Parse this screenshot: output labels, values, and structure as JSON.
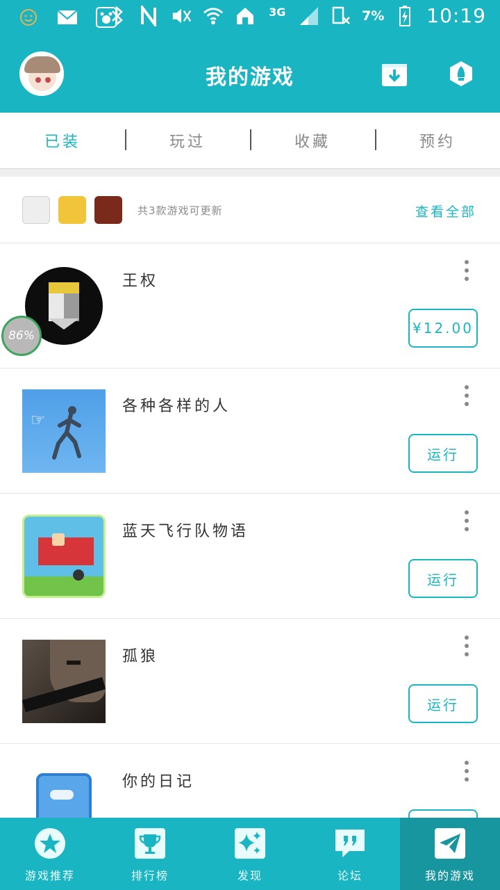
{
  "status_bar": {
    "network_label": "3G",
    "battery_percent": "7%",
    "time": "10:19"
  },
  "header": {
    "title": "我的游戏"
  },
  "tabs": [
    {
      "label": "已装",
      "active": true
    },
    {
      "label": "玩过",
      "active": false
    },
    {
      "label": "收藏",
      "active": false
    },
    {
      "label": "预约",
      "active": false
    }
  ],
  "updates": {
    "text": "共3款游戏可更新",
    "link": "查看全部"
  },
  "games": [
    {
      "name": "王权",
      "action": "¥12.00",
      "progress_badge": "86%"
    },
    {
      "name": "各种各样的人",
      "action": "运行"
    },
    {
      "name": "蓝天飞行队物语",
      "action": "运行"
    },
    {
      "name": "孤狼",
      "action": "运行"
    },
    {
      "name": "你的日记",
      "action": ""
    }
  ],
  "bottom_nav": [
    {
      "label": "游戏推荐",
      "icon": "star-icon",
      "active": false
    },
    {
      "label": "排行榜",
      "icon": "trophy-icon",
      "active": false
    },
    {
      "label": "发现",
      "icon": "sparkle-icon",
      "active": false
    },
    {
      "label": "论坛",
      "icon": "quote-bubble-icon",
      "active": false
    },
    {
      "label": "我的游戏",
      "icon": "paper-plane-icon",
      "active": true
    }
  ],
  "colors": {
    "accent": "#1ab5c2",
    "nav_active": "#17969f"
  }
}
